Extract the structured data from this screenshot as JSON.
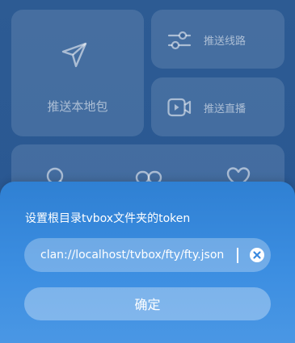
{
  "tiles": {
    "push_package": {
      "label": "推送本地包",
      "icon": "send-icon"
    },
    "push_route": {
      "label": "推送线路",
      "icon": "sliders-icon"
    },
    "push_live": {
      "label": "推送直播",
      "icon": "video-icon"
    },
    "row_icons": [
      "search-icon",
      "link-icon",
      "heart-icon"
    ]
  },
  "dialog": {
    "title": "设置根目录tvbox文件夹的token",
    "input_value": "clan://localhost/tvbox/fty/fty.json",
    "clear_icon": "clear-icon",
    "confirm_label": "确定"
  },
  "colors": {
    "background": "#2a5a92",
    "sheet": "#3a8cdf",
    "text": "#ffffff"
  }
}
